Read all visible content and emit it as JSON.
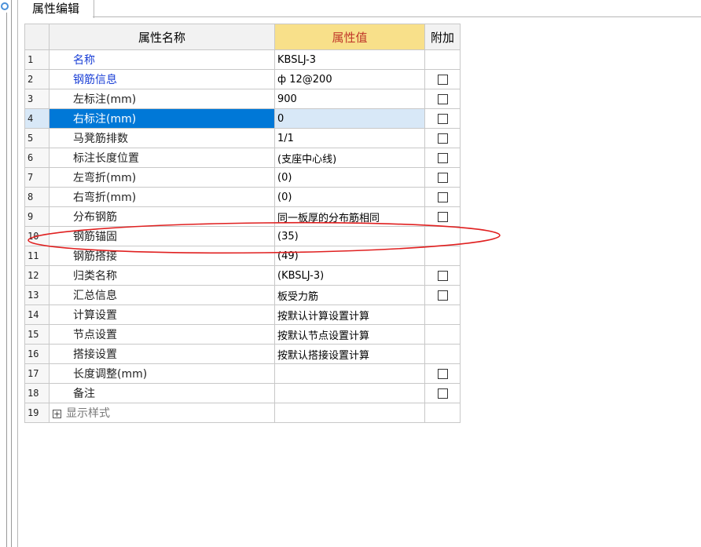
{
  "tab": {
    "title": "属性编辑"
  },
  "grid": {
    "headers": {
      "name": "属性名称",
      "value": "属性值",
      "attach": "附加"
    },
    "rows": [
      {
        "n": "1",
        "name": "名称",
        "value": "KBSLJ-3",
        "check": false,
        "blue": true
      },
      {
        "n": "2",
        "name": "钢筋信息",
        "value": "ф 12@200",
        "check": true,
        "blue": true
      },
      {
        "n": "3",
        "name": "左标注(mm)",
        "value": "900",
        "check": true
      },
      {
        "n": "4",
        "name": "右标注(mm)",
        "value": "0",
        "check": true,
        "selected": true
      },
      {
        "n": "5",
        "name": "马凳筋排数",
        "value": "1/1",
        "check": true
      },
      {
        "n": "6",
        "name": "标注长度位置",
        "value": "(支座中心线)",
        "check": true
      },
      {
        "n": "7",
        "name": "左弯折(mm)",
        "value": "(0)",
        "check": true
      },
      {
        "n": "8",
        "name": "右弯折(mm)",
        "value": "(0)",
        "check": true
      },
      {
        "n": "9",
        "name": "分布钢筋",
        "value": "同一板厚的分布筋相同",
        "check": true
      },
      {
        "n": "10",
        "name": "钢筋锚固",
        "value": "(35)",
        "check": false
      },
      {
        "n": "11",
        "name": "钢筋搭接",
        "value": "(49)",
        "check": false
      },
      {
        "n": "12",
        "name": "归类名称",
        "value": "(KBSLJ-3)",
        "check": true
      },
      {
        "n": "13",
        "name": "汇总信息",
        "value": "板受力筋",
        "check": true
      },
      {
        "n": "14",
        "name": "计算设置",
        "value": "按默认计算设置计算",
        "check": false
      },
      {
        "n": "15",
        "name": "节点设置",
        "value": "按默认节点设置计算",
        "check": false
      },
      {
        "n": "16",
        "name": "搭接设置",
        "value": "按默认搭接设置计算",
        "check": false
      },
      {
        "n": "17",
        "name": "长度调整(mm)",
        "value": "",
        "check": true
      },
      {
        "n": "18",
        "name": "备注",
        "value": "",
        "check": true
      },
      {
        "n": "19",
        "name": "显示样式",
        "value": "",
        "check": false,
        "expandable": true,
        "gray": true
      }
    ]
  },
  "colors": {
    "selected": "#0078d7",
    "header_value_bg": "#f8e08a",
    "header_value_text": "#c0392b",
    "link_blue": "#1a3fd6",
    "annotation_red": "#e02020"
  }
}
